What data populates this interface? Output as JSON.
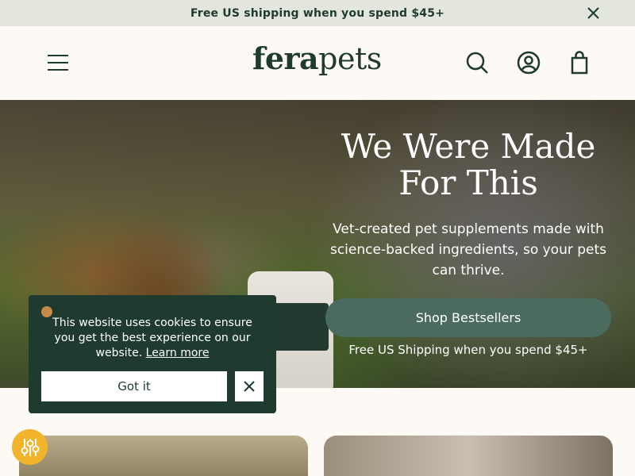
{
  "announcement": {
    "text": "Free US shipping when you spend $45+"
  },
  "header": {
    "logo_bold": "fera",
    "logo_light": "pets"
  },
  "hero": {
    "title": "We Were Made For This",
    "subtitle": "Vet-created pet supplements made with science-backed ingredients, so your pets can thrive.",
    "cta_label": "Shop Bestsellers",
    "shipping_note": "Free US Shipping when you spend $45+"
  },
  "cookie_banner": {
    "message": "This website uses cookies to ensure you get the best experience on our website.",
    "learn_more": "Learn more",
    "accept_label": "Got it"
  },
  "icons": {
    "announcement_close": "close-icon",
    "menu": "hamburger-menu-icon",
    "search": "search-icon",
    "account": "user-account-icon",
    "cart": "shopping-bag-icon",
    "cookie": "cookie-icon",
    "cookie_close": "close-icon",
    "accessibility": "accessibility-sliders-icon"
  },
  "colors": {
    "brand_dark_green": "#1f3a2f",
    "cta_green": "#4a6b5e",
    "announcement_bg": "#e3e6dd",
    "page_bg": "#fdf9f4",
    "accessibility_yellow": "#f2b42a"
  }
}
